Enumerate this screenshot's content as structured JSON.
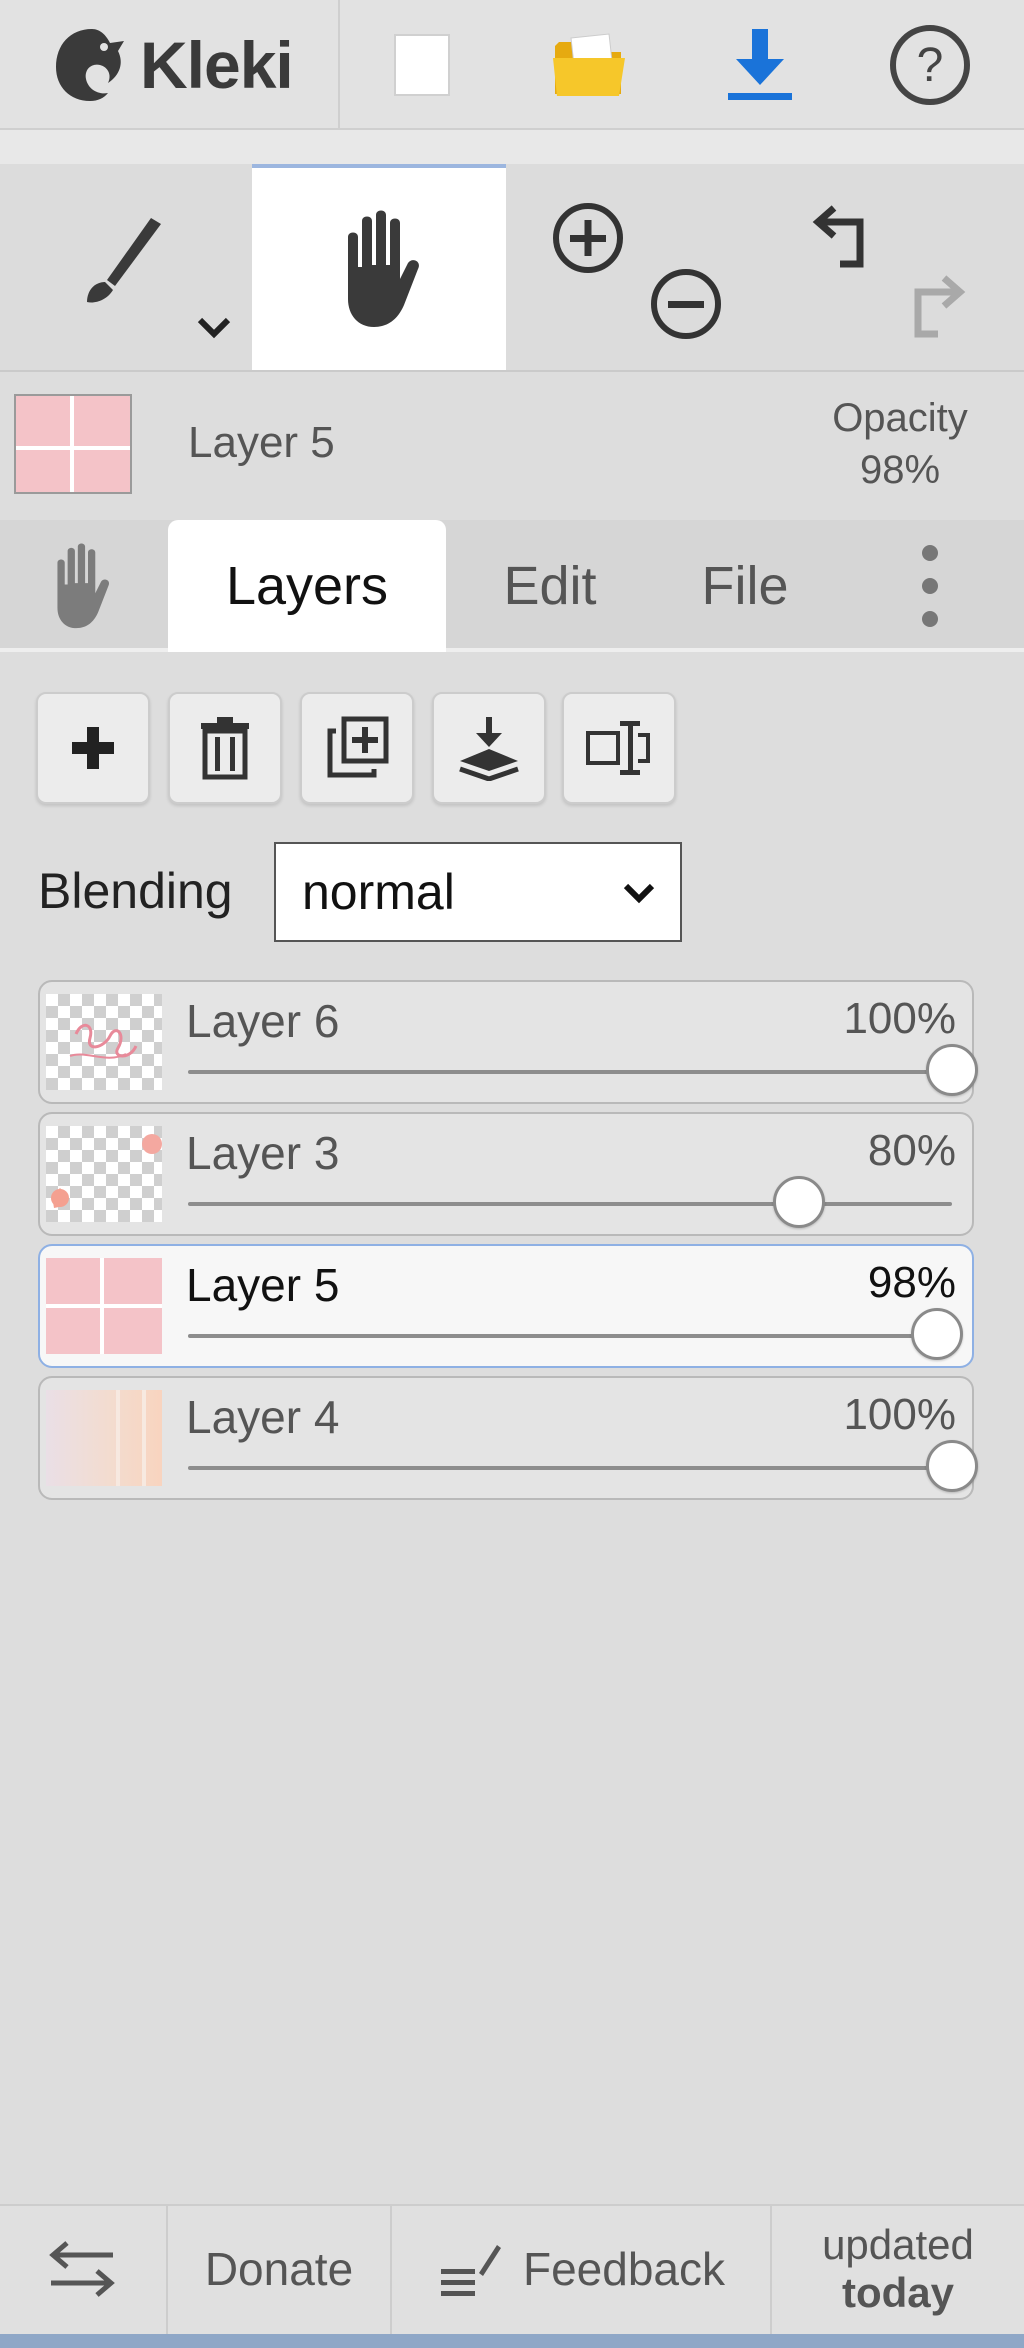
{
  "app": {
    "name": "Kleki"
  },
  "header": {
    "buttons": [
      {
        "name": "new-image",
        "icon": "blank-page-icon"
      },
      {
        "name": "open-file",
        "icon": "folder-icon"
      },
      {
        "name": "download",
        "icon": "download-icon"
      },
      {
        "name": "help",
        "icon": "help-icon"
      }
    ]
  },
  "toolbar": {
    "tools": [
      {
        "name": "brush",
        "icon": "brush-icon",
        "active": false
      },
      {
        "name": "hand",
        "icon": "hand-icon",
        "active": true
      },
      {
        "name": "zoom",
        "icon": "zoom-in-out-icon"
      },
      {
        "name": "history",
        "icon": "undo-redo-icon"
      }
    ]
  },
  "current_layer": {
    "name": "Layer 5",
    "opacity_label": "Opacity",
    "opacity_value": "98%"
  },
  "tabs": {
    "items": [
      {
        "label": "Layers",
        "active": true
      },
      {
        "label": "Edit",
        "active": false
      },
      {
        "label": "File",
        "active": false
      }
    ]
  },
  "layer_actions": [
    {
      "name": "add-layer",
      "icon": "plus-icon"
    },
    {
      "name": "delete-layer",
      "icon": "trash-icon"
    },
    {
      "name": "duplicate-layer",
      "icon": "duplicate-icon"
    },
    {
      "name": "merge-down",
      "icon": "merge-down-icon"
    },
    {
      "name": "rename-layer",
      "icon": "rename-icon"
    }
  ],
  "blending": {
    "label": "Blending",
    "value": "normal"
  },
  "layers": [
    {
      "name": "Layer 6",
      "opacity": "100%",
      "opacity_fraction": 1.0,
      "active": false
    },
    {
      "name": "Layer 3",
      "opacity": "80%",
      "opacity_fraction": 0.8,
      "active": false
    },
    {
      "name": "Layer 5",
      "opacity": "98%",
      "opacity_fraction": 0.98,
      "active": true
    },
    {
      "name": "Layer 4",
      "opacity": "100%",
      "opacity_fraction": 1.0,
      "active": false
    }
  ],
  "footer": {
    "donate": "Donate",
    "feedback": "Feedback",
    "updated_line1": "updated",
    "updated_line2": "today"
  },
  "colors": {
    "accent_blue": "#1a73d9",
    "folder_yellow": "#f2c222",
    "active_outline": "#8eb0e4",
    "layer_pink": "#f4c3c8"
  }
}
